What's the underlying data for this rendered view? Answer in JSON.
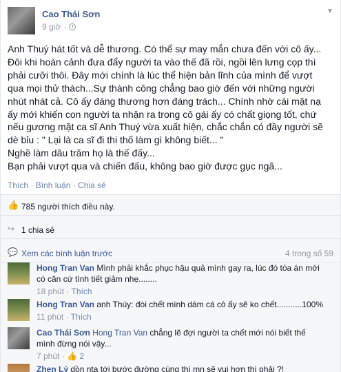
{
  "post": {
    "author": "Cao Thái Sơn",
    "time": "9 giờ",
    "body_lines": [
      "Anh Thuý hát tốt và dễ thương. Có thể sự may mắn chưa đến với cô ấy...",
      "Đôi khi hoàn cảnh đưa đẩy người ta vào thế đã rồi, ngồi lên lưng cọp thì",
      "phải cưỡi thôi. Đây mới chính là lúc thể hiện bản lĩnh của mình để vượt",
      "qua mọi thử thách...Sự thành công chẳng bao giờ đến với những người",
      "nhút nhát cả. Cô ấy đáng thương hơn đáng trách... Chính nhờ cái mặt nạ",
      "ấy mới khiến con người ta nhận ra trong cô gái ấy có chất giọng tốt, chứ",
      "nếu gương mặt ca sĩ Anh Thuý vừa xuất hiện, chắc chắn có đầy người sẽ",
      "dè bỉu : \" Lại là ca sĩ đi thi thố làm gì không biết... \"",
      "Nghề làm dâu trăm họ là thế đấy...",
      "Bạn phải vượt qua và chiến đấu, không bao giờ được gục ngã..."
    ]
  },
  "actions": {
    "like": "Thích",
    "comment": "Bình luận",
    "share": "Chia sẻ",
    "sep": "·"
  },
  "feedback": {
    "likes_text": "785 người thích điều này.",
    "shares_text": "1 chia sẻ",
    "prev_comments": "Xem các bình luận trước",
    "count_text": "4 trong số 59"
  },
  "comments": [
    {
      "author": "Hong Tran Van",
      "tag": "",
      "text_lines": [
        "Mình phải khắc phục hậu quả mình gay ra, lúc đó tòa án mới",
        "có căn cứ tình tiết giảm nhẹ........"
      ],
      "time": "18 phút",
      "like": "Thích",
      "likes": ""
    },
    {
      "author": "Hong Tran Van",
      "tag": "",
      "text_lines": [
        "anh Thúy: đòi chết mình dám cá cô ấy sẽ ko chết...........100%"
      ],
      "time": "11 phút",
      "like": "Thích",
      "likes": ""
    },
    {
      "author": "Cao Thái Sơn",
      "tag": "Hong Tran Van",
      "text_lines": [
        "chẳng lẽ đợi người ta chết mới nói biết thế",
        "mình đừng nói vậy..."
      ],
      "time": "7 phút",
      "like": "Thích",
      "likes": "2"
    },
    {
      "author": "Zhen Lý",
      "tag": "",
      "text_lines": [
        "dồn nta tới bước đường cùng thì mn sẽ vui hơn thì phải ?!"
      ],
      "time": "",
      "like": "",
      "likes": ""
    }
  ],
  "colors": {
    "link": "#3b5998",
    "meta": "#9197a3",
    "feedback_bg": "#f6f7f8"
  },
  "icons": {
    "clock": "clock-icon",
    "like": "thumbs-up-icon",
    "share": "share-arrow-icon",
    "comment_bubble": "speech-bubble-icon",
    "options": "chevron-down-icon"
  }
}
